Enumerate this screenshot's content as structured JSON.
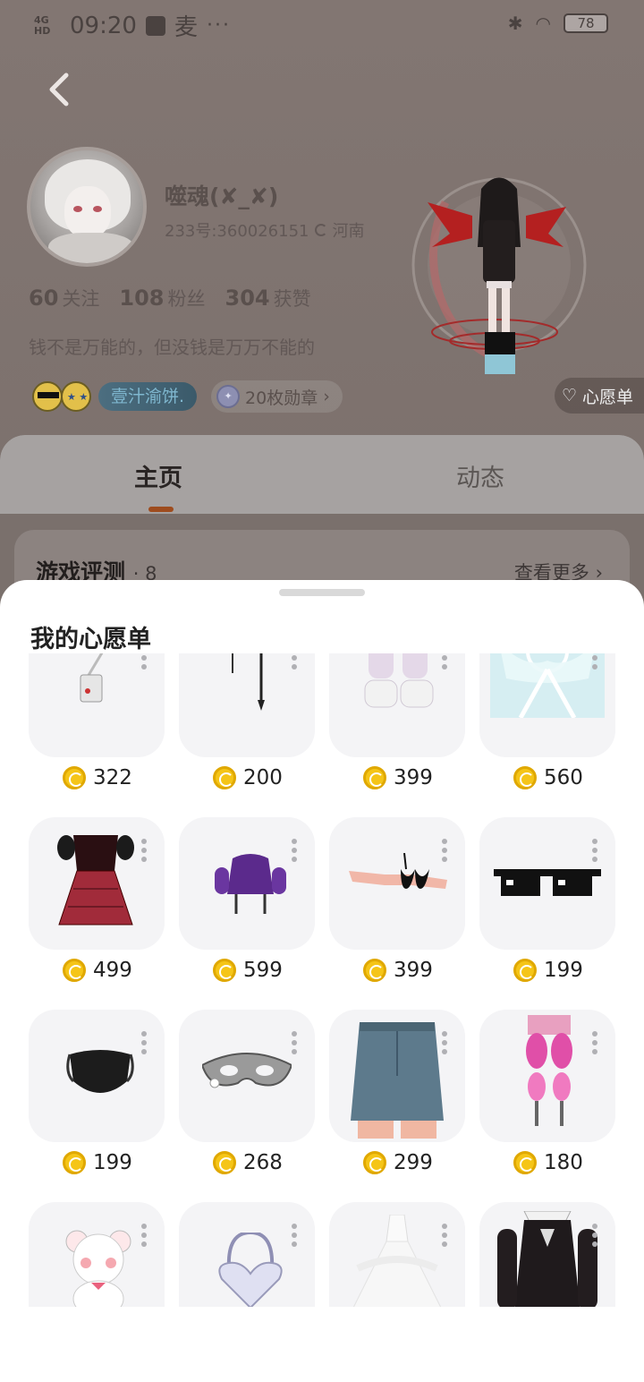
{
  "status_bar": {
    "network": "4G HD",
    "time": "09:20",
    "app_label": "麦",
    "more": "···",
    "battery": "78"
  },
  "profile": {
    "username": "噬魂(✘_✘)",
    "id_text": "233号:360026151",
    "location": "河南",
    "stats": [
      {
        "num": "60",
        "label": "关注"
      },
      {
        "num": "108",
        "label": "粉丝"
      },
      {
        "num": "304",
        "label": "获赞"
      }
    ],
    "bio": "钱不是万能的，但没钱是万万不能的",
    "nickname_tag": "壹汁渝饼.",
    "medals": "20枚勋章",
    "wishlist_button": "心愿单"
  },
  "tabs": {
    "home": "主页",
    "feed": "动态"
  },
  "section": {
    "title": "游戏评测",
    "count": "· 8",
    "more": "查看更多 ›"
  },
  "wishlist": {
    "title": "我的心愿单",
    "items": [
      {
        "name": "bag-item",
        "price": "322"
      },
      {
        "name": "earrings-item",
        "price": "200"
      },
      {
        "name": "socks-shoes-item",
        "price": "399"
      },
      {
        "name": "wings-background-item",
        "price": "560"
      },
      {
        "name": "plaid-dress-item",
        "price": "499"
      },
      {
        "name": "purple-jacket-item",
        "price": "599"
      },
      {
        "name": "bikini-top-item",
        "price": "399"
      },
      {
        "name": "pixel-sunglasses-item",
        "price": "199"
      },
      {
        "name": "black-mask-item",
        "price": "199"
      },
      {
        "name": "lace-eye-mask-item",
        "price": "268"
      },
      {
        "name": "denim-skirt-item",
        "price": "299"
      },
      {
        "name": "pink-leg-accessory-item",
        "price": "180"
      },
      {
        "name": "bear-plush-item",
        "price": ""
      },
      {
        "name": "heart-bag-item",
        "price": ""
      },
      {
        "name": "white-gown-item",
        "price": ""
      },
      {
        "name": "black-sailor-dress-item",
        "price": ""
      }
    ]
  },
  "colors": {
    "coin": "#f5c518",
    "tab_indicator": "#9e4c1e",
    "sheet_bg": "#ffffff",
    "thumb_bg": "#f4f4f6"
  }
}
